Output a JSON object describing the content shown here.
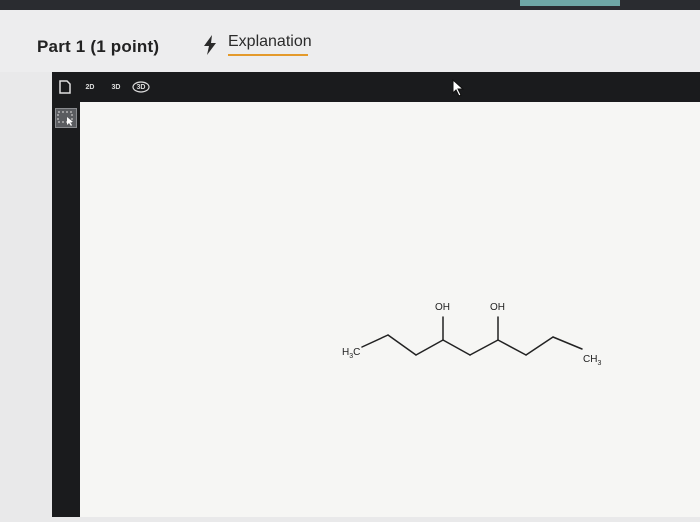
{
  "header": {
    "part_title": "Part 1  (1 point)",
    "explanation_label": "Explanation"
  },
  "toolbar": {
    "icons": [
      "new-document-icon",
      "2d-template-icon",
      "3d-template-icon",
      "3d-view-icon"
    ],
    "icon_labels": {
      "two_d": "2D",
      "three_d": "3D",
      "view_3d": "3D"
    }
  },
  "molecule": {
    "left_terminal": {
      "base": "H",
      "sub": "3",
      "tail": "C"
    },
    "right_terminal": {
      "base": "CH",
      "sub": "3"
    },
    "hydroxyl_labels": [
      "OH",
      "OH"
    ]
  },
  "colors": {
    "accent_underline": "#e49a2b",
    "toolbar_bg": "#1a1b1d",
    "canvas_bg": "#f6f6f4"
  }
}
